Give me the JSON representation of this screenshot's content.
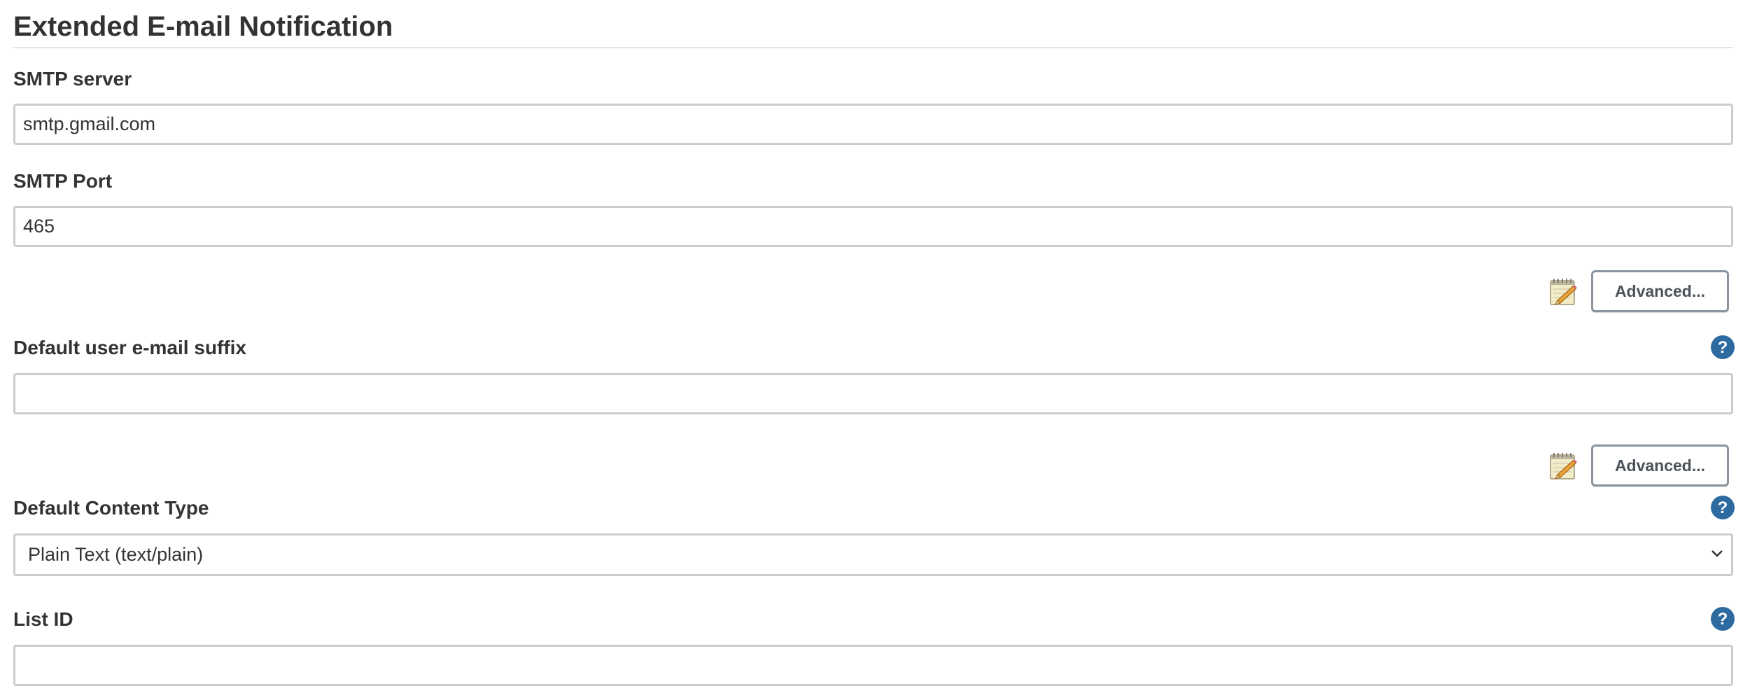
{
  "section": {
    "title": "Extended E-mail Notification"
  },
  "fields": {
    "smtp_server": {
      "label": "SMTP server",
      "value": "smtp.gmail.com"
    },
    "smtp_port": {
      "label": "SMTP Port",
      "value": "465"
    },
    "default_suffix": {
      "label": "Default user e-mail suffix",
      "value": ""
    },
    "content_type": {
      "label": "Default Content Type",
      "selected": "Plain Text (text/plain)"
    },
    "list_id": {
      "label": "List ID",
      "value": ""
    }
  },
  "buttons": {
    "advanced_1": "Advanced...",
    "advanced_2": "Advanced..."
  },
  "icons": {
    "notepad": "notepad-pencil-icon",
    "help": "help-icon",
    "chevron": "chevron-down-icon"
  },
  "colors": {
    "help_blue": "#2d6aa0",
    "text": "#333333",
    "border": "#cccccc"
  }
}
